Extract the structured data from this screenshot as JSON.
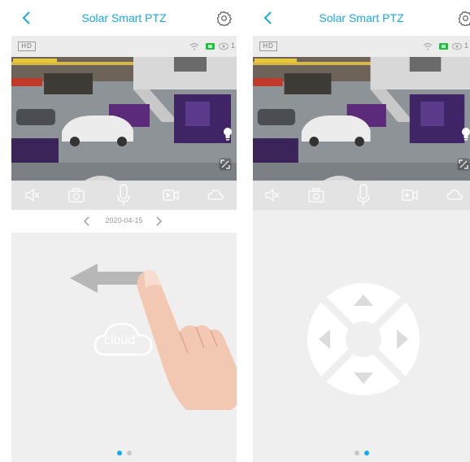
{
  "colors": {
    "accent": "#1aa7ec",
    "dot_active": "#1aa7ec",
    "dot_inactive": "#c8c8c8",
    "battery": "#19c23a",
    "panel_bg": "#efefef",
    "controls_bg": "#e3e3e3"
  },
  "screens": [
    {
      "id": "playback",
      "header": {
        "title": "Solar Smart PTZ",
        "back_icon": "chevron-left-icon",
        "settings_icon": "gear-icon"
      },
      "video": {
        "quality_badge": "HD",
        "wifi_icon": "wifi-icon",
        "battery_icon": "battery-icon",
        "viewer_icon": "eye-icon",
        "viewer_count": "1",
        "fullscreen_icon": "expand-icon",
        "light_icon": "bulb-icon"
      },
      "controls": [
        "mute-icon",
        "snapshot-icon",
        "microphone-icon",
        "record-icon",
        "cloud-icon"
      ],
      "date": {
        "value": "2020-04-15",
        "prev_icon": "chevron-left-icon",
        "next_icon": "chevron-right-icon"
      },
      "panel": {
        "cloud_label": "cloud",
        "gesture": "swipe-left-hand"
      },
      "pager": {
        "count": 2,
        "active": 0
      }
    },
    {
      "id": "ptz",
      "header": {
        "title": "Solar Smart PTZ",
        "back_icon": "chevron-left-icon",
        "settings_icon": "gear-icon"
      },
      "video": {
        "quality_badge": "HD",
        "wifi_icon": "wifi-icon",
        "battery_icon": "battery-icon",
        "viewer_icon": "eye-icon",
        "viewer_count": "1",
        "fullscreen_icon": "expand-icon",
        "light_icon": "bulb-icon"
      },
      "controls": [
        "mute-icon",
        "snapshot-icon",
        "microphone-icon",
        "record-icon",
        "cloud-icon"
      ],
      "panel": {
        "ptz_buttons": [
          "up",
          "right",
          "down",
          "left"
        ]
      },
      "pager": {
        "count": 2,
        "active": 1
      }
    }
  ]
}
